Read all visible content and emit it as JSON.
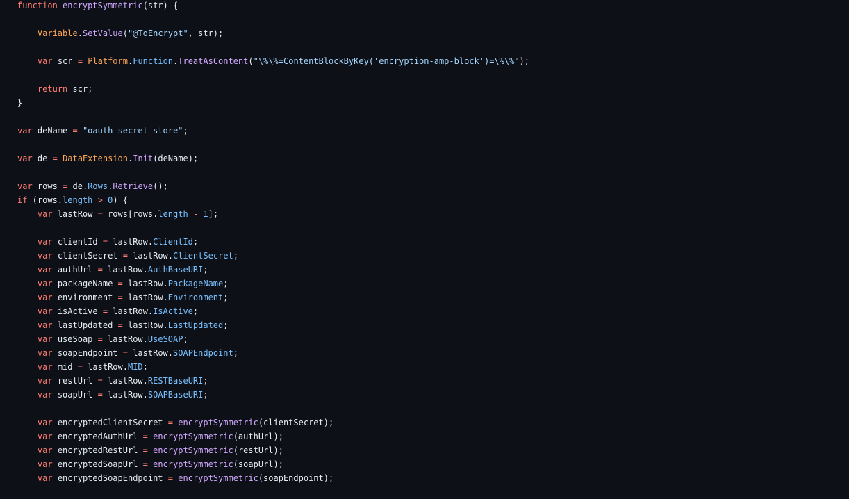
{
  "colors": {
    "background": "#0d1117",
    "plain": "#e6edf3",
    "keyword": "#ff7b72",
    "function": "#d2a8ff",
    "class": "#ffa657",
    "property": "#79c0ff",
    "string": "#a5d6ff"
  },
  "code": {
    "language": "javascript",
    "lines": [
      [
        [
          "kw",
          "function"
        ],
        [
          "pl",
          " "
        ],
        [
          "fn",
          "encryptSymmetric"
        ],
        [
          "pl",
          "(str) {"
        ]
      ],
      [],
      [
        [
          "pl",
          "    "
        ],
        [
          "cl",
          "Variable"
        ],
        [
          "pl",
          "."
        ],
        [
          "fn",
          "SetValue"
        ],
        [
          "pl",
          "("
        ],
        [
          "str",
          "\"@ToEncrypt\""
        ],
        [
          "pl",
          ", str);"
        ]
      ],
      [],
      [
        [
          "pl",
          "    "
        ],
        [
          "kw",
          "var"
        ],
        [
          "pl",
          " scr "
        ],
        [
          "kw",
          "="
        ],
        [
          "pl",
          " "
        ],
        [
          "cl",
          "Platform"
        ],
        [
          "pl",
          "."
        ],
        [
          "prop",
          "Function"
        ],
        [
          "pl",
          "."
        ],
        [
          "fn",
          "TreatAsContent"
        ],
        [
          "pl",
          "("
        ],
        [
          "str",
          "\"\\%\\%=ContentBlockByKey('encryption-amp-block')=\\%\\%\""
        ],
        [
          "pl",
          ");"
        ]
      ],
      [],
      [
        [
          "pl",
          "    "
        ],
        [
          "kw",
          "return"
        ],
        [
          "pl",
          " scr;"
        ]
      ],
      [
        [
          "pl",
          "}"
        ]
      ],
      [],
      [
        [
          "kw",
          "var"
        ],
        [
          "pl",
          " deName "
        ],
        [
          "kw",
          "="
        ],
        [
          "pl",
          " "
        ],
        [
          "str",
          "\"oauth-secret-store\""
        ],
        [
          "pl",
          ";"
        ]
      ],
      [],
      [
        [
          "kw",
          "var"
        ],
        [
          "pl",
          " de "
        ],
        [
          "kw",
          "="
        ],
        [
          "pl",
          " "
        ],
        [
          "cl",
          "DataExtension"
        ],
        [
          "pl",
          "."
        ],
        [
          "fn",
          "Init"
        ],
        [
          "pl",
          "(deName);"
        ]
      ],
      [],
      [
        [
          "kw",
          "var"
        ],
        [
          "pl",
          " rows "
        ],
        [
          "kw",
          "="
        ],
        [
          "pl",
          " de."
        ],
        [
          "prop",
          "Rows"
        ],
        [
          "pl",
          "."
        ],
        [
          "fn",
          "Retrieve"
        ],
        [
          "pl",
          "();"
        ]
      ],
      [
        [
          "kw",
          "if"
        ],
        [
          "pl",
          " (rows."
        ],
        [
          "prop",
          "length"
        ],
        [
          "pl",
          " "
        ],
        [
          "kw",
          ">"
        ],
        [
          "pl",
          " "
        ],
        [
          "num",
          "0"
        ],
        [
          "pl",
          ") {"
        ]
      ],
      [
        [
          "pl",
          "    "
        ],
        [
          "kw",
          "var"
        ],
        [
          "pl",
          " lastRow "
        ],
        [
          "kw",
          "="
        ],
        [
          "pl",
          " rows[rows."
        ],
        [
          "prop",
          "length"
        ],
        [
          "pl",
          " "
        ],
        [
          "kw",
          "-"
        ],
        [
          "pl",
          " "
        ],
        [
          "num",
          "1"
        ],
        [
          "pl",
          "];"
        ]
      ],
      [],
      [
        [
          "pl",
          "    "
        ],
        [
          "kw",
          "var"
        ],
        [
          "pl",
          " clientId "
        ],
        [
          "kw",
          "="
        ],
        [
          "pl",
          " lastRow."
        ],
        [
          "prop",
          "ClientId"
        ],
        [
          "pl",
          ";"
        ]
      ],
      [
        [
          "pl",
          "    "
        ],
        [
          "kw",
          "var"
        ],
        [
          "pl",
          " clientSecret "
        ],
        [
          "kw",
          "="
        ],
        [
          "pl",
          " lastRow."
        ],
        [
          "prop",
          "ClientSecret"
        ],
        [
          "pl",
          ";"
        ]
      ],
      [
        [
          "pl",
          "    "
        ],
        [
          "kw",
          "var"
        ],
        [
          "pl",
          " authUrl "
        ],
        [
          "kw",
          "="
        ],
        [
          "pl",
          " lastRow."
        ],
        [
          "prop",
          "AuthBaseURI"
        ],
        [
          "pl",
          ";"
        ]
      ],
      [
        [
          "pl",
          "    "
        ],
        [
          "kw",
          "var"
        ],
        [
          "pl",
          " packageName "
        ],
        [
          "kw",
          "="
        ],
        [
          "pl",
          " lastRow."
        ],
        [
          "prop",
          "PackageName"
        ],
        [
          "pl",
          ";"
        ]
      ],
      [
        [
          "pl",
          "    "
        ],
        [
          "kw",
          "var"
        ],
        [
          "pl",
          " environment "
        ],
        [
          "kw",
          "="
        ],
        [
          "pl",
          " lastRow."
        ],
        [
          "prop",
          "Environment"
        ],
        [
          "pl",
          ";"
        ]
      ],
      [
        [
          "pl",
          "    "
        ],
        [
          "kw",
          "var"
        ],
        [
          "pl",
          " isActive "
        ],
        [
          "kw",
          "="
        ],
        [
          "pl",
          " lastRow."
        ],
        [
          "prop",
          "IsActive"
        ],
        [
          "pl",
          ";"
        ]
      ],
      [
        [
          "pl",
          "    "
        ],
        [
          "kw",
          "var"
        ],
        [
          "pl",
          " lastUpdated "
        ],
        [
          "kw",
          "="
        ],
        [
          "pl",
          " lastRow."
        ],
        [
          "prop",
          "LastUpdated"
        ],
        [
          "pl",
          ";"
        ]
      ],
      [
        [
          "pl",
          "    "
        ],
        [
          "kw",
          "var"
        ],
        [
          "pl",
          " useSoap "
        ],
        [
          "kw",
          "="
        ],
        [
          "pl",
          " lastRow."
        ],
        [
          "prop",
          "UseSOAP"
        ],
        [
          "pl",
          ";"
        ]
      ],
      [
        [
          "pl",
          "    "
        ],
        [
          "kw",
          "var"
        ],
        [
          "pl",
          " soapEndpoint "
        ],
        [
          "kw",
          "="
        ],
        [
          "pl",
          " lastRow."
        ],
        [
          "prop",
          "SOAPEndpoint"
        ],
        [
          "pl",
          ";"
        ]
      ],
      [
        [
          "pl",
          "    "
        ],
        [
          "kw",
          "var"
        ],
        [
          "pl",
          " mid "
        ],
        [
          "kw",
          "="
        ],
        [
          "pl",
          " lastRow."
        ],
        [
          "prop",
          "MID"
        ],
        [
          "pl",
          ";"
        ]
      ],
      [
        [
          "pl",
          "    "
        ],
        [
          "kw",
          "var"
        ],
        [
          "pl",
          " restUrl "
        ],
        [
          "kw",
          "="
        ],
        [
          "pl",
          " lastRow."
        ],
        [
          "prop",
          "RESTBaseURI"
        ],
        [
          "pl",
          ";"
        ]
      ],
      [
        [
          "pl",
          "    "
        ],
        [
          "kw",
          "var"
        ],
        [
          "pl",
          " soapUrl "
        ],
        [
          "kw",
          "="
        ],
        [
          "pl",
          " lastRow."
        ],
        [
          "prop",
          "SOAPBaseURI"
        ],
        [
          "pl",
          ";"
        ]
      ],
      [],
      [
        [
          "pl",
          "    "
        ],
        [
          "kw",
          "var"
        ],
        [
          "pl",
          " encryptedClientSecret "
        ],
        [
          "kw",
          "="
        ],
        [
          "pl",
          " "
        ],
        [
          "fn",
          "encryptSymmetric"
        ],
        [
          "pl",
          "(clientSecret);"
        ]
      ],
      [
        [
          "pl",
          "    "
        ],
        [
          "kw",
          "var"
        ],
        [
          "pl",
          " encryptedAuthUrl "
        ],
        [
          "kw",
          "="
        ],
        [
          "pl",
          " "
        ],
        [
          "fn",
          "encryptSymmetric"
        ],
        [
          "pl",
          "(authUrl);"
        ]
      ],
      [
        [
          "pl",
          "    "
        ],
        [
          "kw",
          "var"
        ],
        [
          "pl",
          " encryptedRestUrl "
        ],
        [
          "kw",
          "="
        ],
        [
          "pl",
          " "
        ],
        [
          "fn",
          "encryptSymmetric"
        ],
        [
          "pl",
          "(restUrl);"
        ]
      ],
      [
        [
          "pl",
          "    "
        ],
        [
          "kw",
          "var"
        ],
        [
          "pl",
          " encryptedSoapUrl "
        ],
        [
          "kw",
          "="
        ],
        [
          "pl",
          " "
        ],
        [
          "fn",
          "encryptSymmetric"
        ],
        [
          "pl",
          "(soapUrl);"
        ]
      ],
      [
        [
          "pl",
          "    "
        ],
        [
          "kw",
          "var"
        ],
        [
          "pl",
          " encryptedSoapEndpoint "
        ],
        [
          "kw",
          "="
        ],
        [
          "pl",
          " "
        ],
        [
          "fn",
          "encryptSymmetric"
        ],
        [
          "pl",
          "(soapEndpoint);"
        ]
      ]
    ]
  }
}
